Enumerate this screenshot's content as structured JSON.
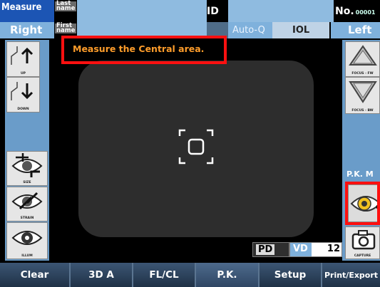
{
  "header": {
    "measure_label": "Measure",
    "eye_right": "Right",
    "last_name_label": "Last name",
    "first_name_label": "First name",
    "id_label": "ID",
    "no_label": "No.",
    "no_value": "00001",
    "auto_q": "Auto-Q",
    "iol": "IOL",
    "eye_left": "Left"
  },
  "left_panel": {
    "up": "UP",
    "down": "DOWN",
    "size": "SIZE",
    "strain": "STRAIN",
    "illum": "ILLUM"
  },
  "right_panel": {
    "focus_fw": "FOCUS - FW",
    "focus_bw": "FOCUS - BW",
    "pk_label": "P.K. M",
    "capture": "CAPTURE"
  },
  "message": "Measure the Central area.",
  "readouts": {
    "pd_label": "PD",
    "vd_label": "VD",
    "vd_value": "12"
  },
  "bottom_tabs": [
    "Clear",
    "3D A",
    "FL/CL",
    "P.K.",
    "Setup",
    "Print/Export"
  ],
  "colors": {
    "header_blue": "#1c55b4",
    "field_blue": "#8fbbe0",
    "highlight_red": "#ff1010",
    "message_orange": "#ff9d2b"
  }
}
